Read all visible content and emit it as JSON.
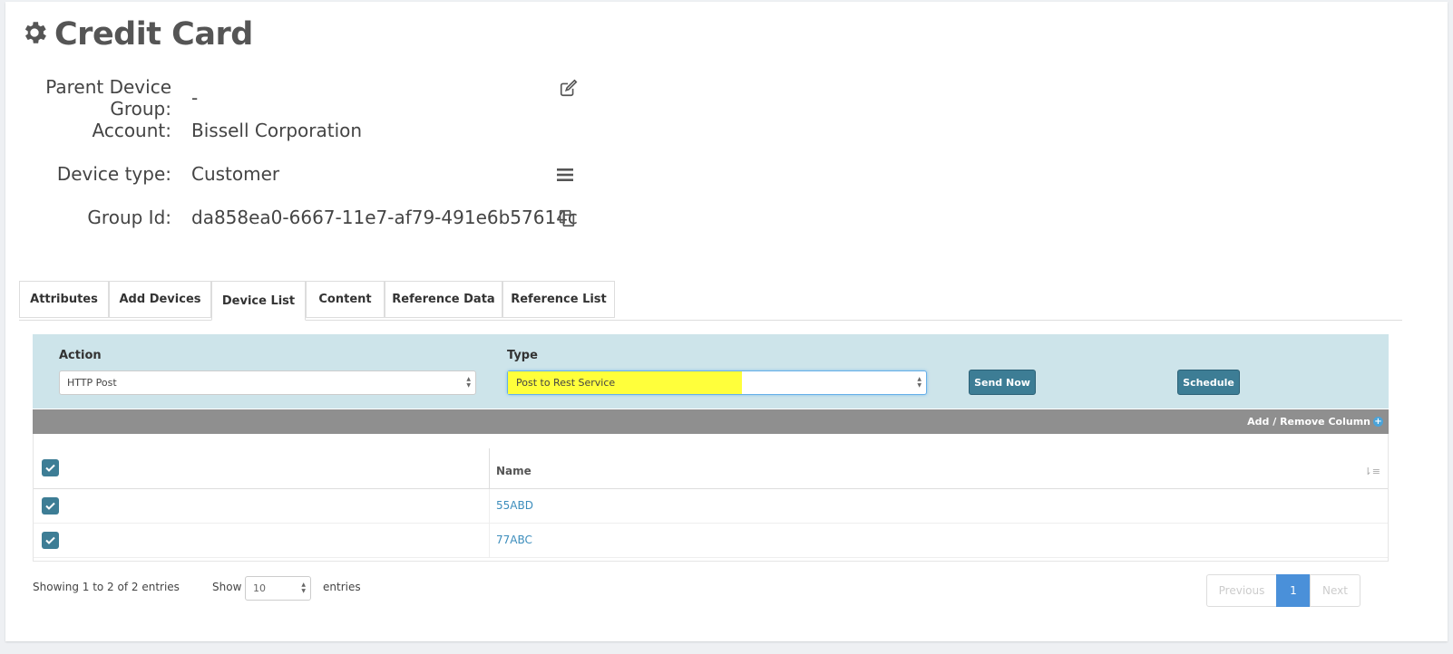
{
  "header": {
    "title": "Credit Card",
    "icon": "gear-icon"
  },
  "info": {
    "parent_device_group": {
      "label": "Parent Device Group:",
      "value": "-"
    },
    "account": {
      "label": "Account:",
      "value": "Bissell Corporation"
    },
    "device_type": {
      "label": "Device type:",
      "value": "Customer"
    },
    "group_id": {
      "label": "Group Id:",
      "value": "da858ea0-6667-11e7-af79-491e6b57614c"
    }
  },
  "tabs": [
    {
      "label": "Attributes",
      "active": false
    },
    {
      "label": "Add Devices",
      "active": false
    },
    {
      "label": "Device List",
      "active": true
    },
    {
      "label": "Content",
      "active": false
    },
    {
      "label": "Reference Data",
      "active": false
    },
    {
      "label": "Reference List",
      "active": false
    }
  ],
  "action_panel": {
    "action_label": "Action",
    "action_value": "HTTP Post",
    "type_label": "Type",
    "type_value": "Post to Rest Service",
    "send_now_label": "Send Now",
    "schedule_label": "Schedule"
  },
  "toolbar": {
    "add_remove_column": "Add / Remove Column"
  },
  "table": {
    "columns": [
      "",
      "Name"
    ],
    "rows": [
      {
        "checked": true,
        "name": "55ABD"
      },
      {
        "checked": true,
        "name": "77ABC"
      }
    ]
  },
  "footer": {
    "info": "Showing 1 to 2 of 2 entries",
    "show_label": "Show",
    "page_size": "10",
    "entries_label": "entries",
    "previous_label": "Previous",
    "current_page": "1",
    "next_label": "Next"
  },
  "colors": {
    "accent": "#3d7d95",
    "panel": "#cde4ea",
    "highlight": "#ffff3b",
    "link": "#3c8dbc",
    "pager_active": "#4a90d9"
  }
}
